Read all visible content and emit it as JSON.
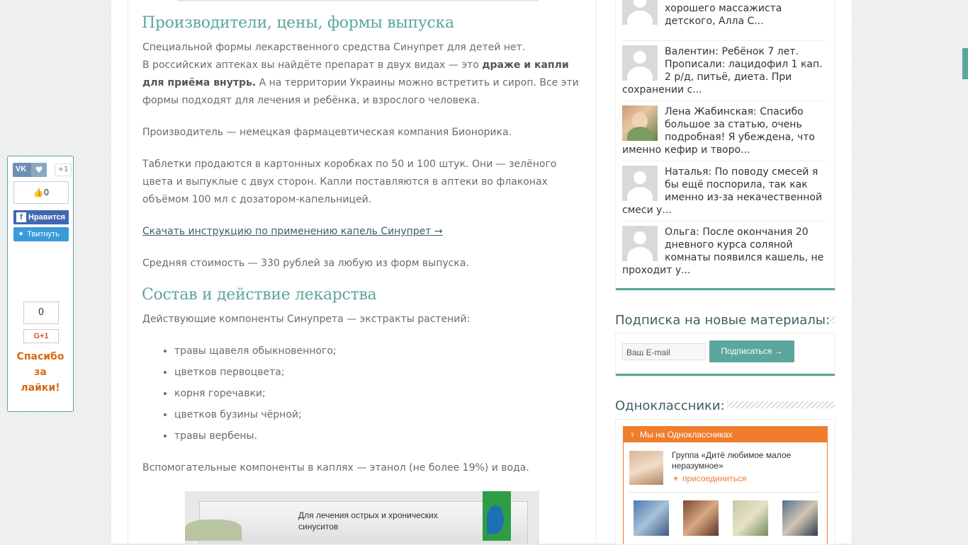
{
  "article": {
    "h_manufacturers": "Производители, цены, формы выпуска",
    "p1_line1": "Специальной формы лекарственного средства Синупрет для детей нет.",
    "p1_line2_a": "В российских аптеках вы найдёте препарат в двух видах — это ",
    "p1_line2_b": "драже и капли для приёма внутрь.",
    "p1_line2_c": " А на территории Украины можно встретить и сироп. Все эти формы подходят для лечения и ребёнка, и взрослого человека.",
    "p2": "Производитель — немецкая фармацевтическая компания Бионорика.",
    "p3": "Таблетки продаются в картонных коробках по 50 и 100 штук. Они — зелёного цвета и выпуклые с двух сторон. Капли поставляются в аптеки во флаконах объёмом 100 мл с дозатором-капельницей.",
    "download_link": "Скачать инструкцию по применению капель Синупрет →",
    "p4": "Средняя стоимость — 330 рублей за любую из форм выпуска.",
    "h_composition": "Состав и действие лекарства",
    "p5": "Действующие компоненты Синупрета — экстракты растений:",
    "ingredients": [
      "травы щавеля обыкновенного;",
      "цветков первоцвета;",
      "корня горечавки;",
      "цветков бузины чёрной;",
      "травы вербены."
    ],
    "p6": "Вспомогательные компоненты в каплях — этанол (не более 19%) и вода.",
    "image_text": "Для лечения острых и хронических синуситов"
  },
  "social": {
    "vk": "VK",
    "plus_one": "+1",
    "like_count": "0",
    "fb_label": "Нравится",
    "tw_label": "Твитнуть",
    "g_count": "0",
    "g_label": "G+1",
    "thanks": "Спасибо за лайки!"
  },
  "comments": [
    {
      "text": "У меня есть контакты хорошего массажиста детского, Алла С..."
    },
    {
      "text": "Валентин: Ребёнок 7 лет. Прописали: лацидофил 1 кап. 2 р/д, питьё, диета. При сохранении с..."
    },
    {
      "text": "Лена Жабинская: Спасибо большое за статью, очень подробная! Я убеждена, что именно кефир и творо..."
    },
    {
      "text": "Наталья: По поводу смесей я бы ещё поспорила, так как именно из-за некачественной смеси у..."
    },
    {
      "text": "Ольга: После окончания 20 дневного курса соляной комнаты появился кашель, не проходит у..."
    }
  ],
  "subscribe": {
    "title": "Подписка на новые материалы:",
    "email_placeholder": "Ваш E-mail",
    "button": "Подписаться →"
  },
  "ok": {
    "title": "Одноклассники:",
    "widget_header": "Мы на Одноклассниках",
    "group_name": "Группа «Дитё любимое малое неразумное»",
    "join": "присоединиться"
  },
  "colors": {
    "accent": "#5ba69d",
    "ok_orange": "#ef7d2d",
    "fb": "#4267b2",
    "tw": "#3a9ad9",
    "vk": "#6d8fb1"
  }
}
